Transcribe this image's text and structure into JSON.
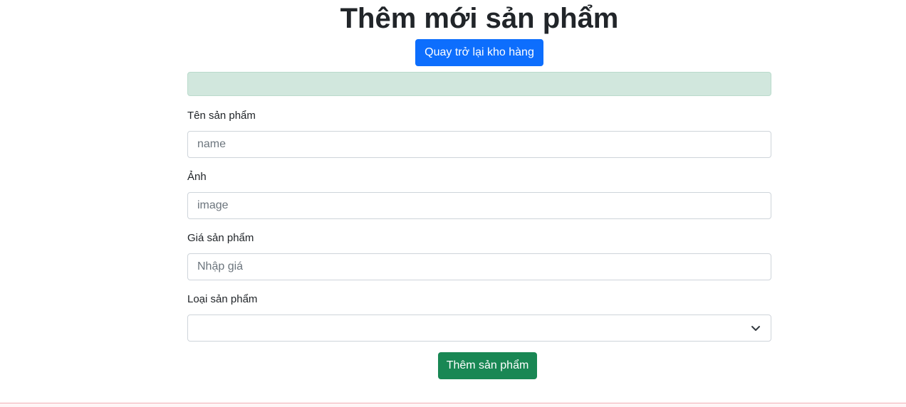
{
  "page": {
    "title": "Thêm mới sản phẩm"
  },
  "header": {
    "back_button_label": "Quay trở lại kho hàng"
  },
  "alert": {
    "message": "",
    "color": "#d1e7dd"
  },
  "form": {
    "name": {
      "label": "Tên sản phẩm",
      "value": "",
      "placeholder": "name"
    },
    "image": {
      "label": "Ảnh",
      "value": "",
      "placeholder": "image"
    },
    "price": {
      "label": "Giá sản phẩm",
      "value": "",
      "placeholder": "Nhập giá"
    },
    "category": {
      "label": "Loại sản phẩm",
      "selected": "",
      "icon": "chevron-down-icon"
    },
    "submit_label": "Thêm sản phẩm"
  },
  "colors": {
    "primary": "#0d6efd",
    "success": "#198754",
    "alert_success_bg": "#d1e7dd",
    "text": "#212529"
  }
}
